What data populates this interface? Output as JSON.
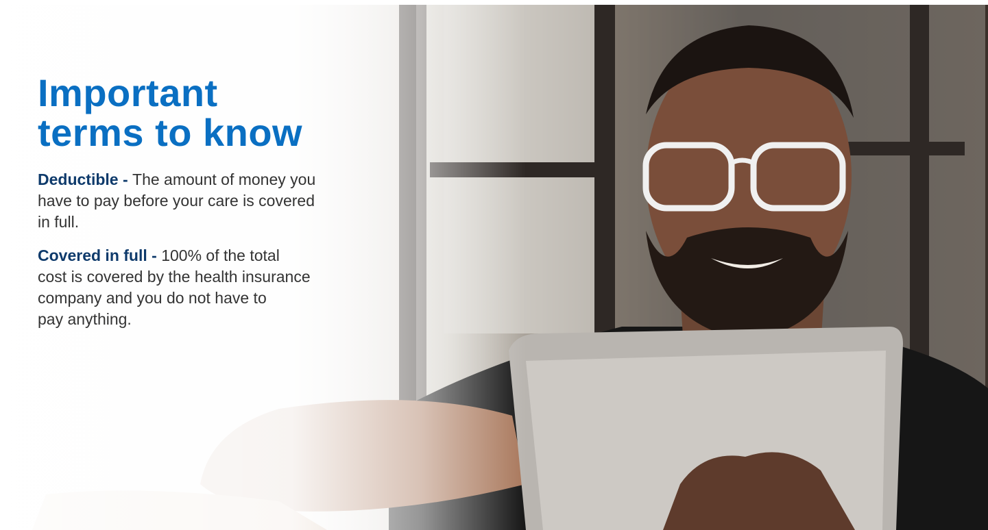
{
  "headline": {
    "line1": "Important",
    "line2": "terms to know"
  },
  "terms": [
    {
      "name": "Deductible",
      "separator": " - ",
      "definition_lines": [
        "The amount of money you",
        "have to pay before your care is covered",
        "in full."
      ]
    },
    {
      "name": "Covered in full",
      "separator": " - ",
      "definition_lines": [
        "100% of the total",
        "cost is covered by the health insurance",
        "company and you do not have to",
        "pay anything."
      ]
    }
  ],
  "photo": {
    "subject": "man-with-glasses-using-tablet-icon"
  },
  "colors": {
    "headline": "#0a6fc2",
    "term_name": "#0e3a6b",
    "body_text": "#333333"
  }
}
